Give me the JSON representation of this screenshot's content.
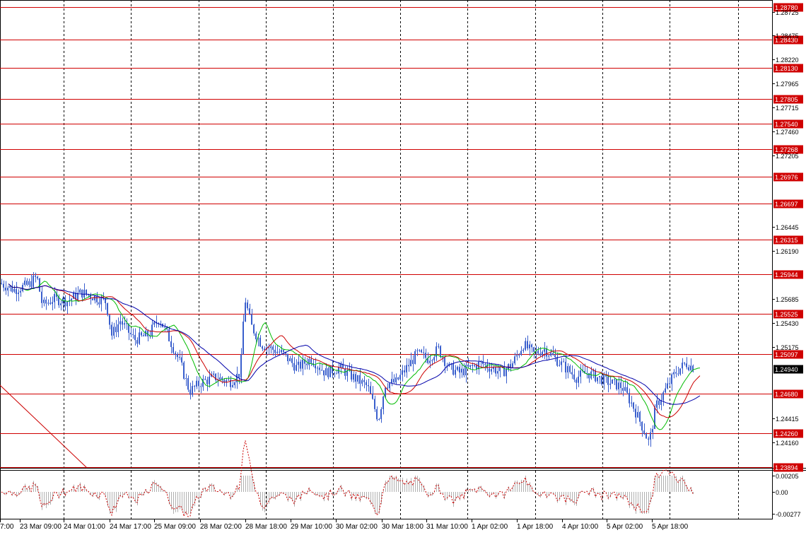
{
  "terminal": {
    "symbol_hint": "GBPUSD",
    "timeframe_hint": "H1"
  },
  "colors": {
    "background": "#ffffff",
    "grid": "#000000",
    "candles": "#3a5fcd",
    "level_line": "#d00000",
    "level_label_bg": "#d00000",
    "current_price_bg": "#000000",
    "ma_fast": "#00bb00",
    "ma_mid": "#cc0000",
    "ma_slow": "#0000aa",
    "trendline": "#cc0000",
    "osc_bars": "#b0b0b0",
    "osc_signal": "#cc0000"
  },
  "price_axis": {
    "ticks": [
      "1.28725",
      "1.28475",
      "1.28220",
      "1.27965",
      "1.27715",
      "1.27460",
      "1.27205",
      "1.26445",
      "1.26190",
      "1.25685",
      "1.25430",
      "1.25175",
      "1.24415",
      "1.24160"
    ]
  },
  "levels": [
    "1.28780",
    "1.28430",
    "1.28130",
    "1.27805",
    "1.27540",
    "1.27268",
    "1.26976",
    "1.26697",
    "1.26315",
    "1.25944",
    "1.25525",
    "1.25097",
    "1.24680",
    "1.24260",
    "1.23894"
  ],
  "current_price": "1.24940",
  "oscillator": {
    "ticks": [
      "0.00205",
      "0.00",
      "-0.00277"
    ]
  },
  "time_axis": {
    "labels": [
      "7:00",
      "23 Mar 09:00",
      "24 Mar 01:00",
      "24 Mar 17:00",
      "25 Mar 09:00",
      "28 Mar 02:00",
      "28 Mar 18:00",
      "29 Mar 10:00",
      "30 Mar 02:00",
      "30 Mar 18:00",
      "31 Mar 10:00",
      "1 Apr 02:00",
      "1 Apr 18:00",
      "4 Apr 10:00",
      "5 Apr 02:00",
      "5 Apr 18:00"
    ]
  },
  "chart_data": {
    "type": "candlestick",
    "price_range": [
      1.2389,
      1.2883
    ],
    "oscillator_range": [
      -0.00277,
      0.00205
    ],
    "horizontal_levels": [
      1.2878,
      1.2843,
      1.2813,
      1.27805,
      1.2754,
      1.27268,
      1.26976,
      1.26697,
      1.26315,
      1.25944,
      1.25525,
      1.25097,
      1.2468,
      1.2426,
      1.23894
    ],
    "close_path": [
      [
        0,
        1.2585
      ],
      [
        20,
        1.2578
      ],
      [
        40,
        1.2583
      ],
      [
        52,
        1.2592
      ],
      [
        60,
        1.2561
      ],
      [
        75,
        1.2568
      ],
      [
        95,
        1.2566
      ],
      [
        115,
        1.2575
      ],
      [
        135,
        1.257
      ],
      [
        150,
        1.2565
      ],
      [
        158,
        1.253
      ],
      [
        170,
        1.2545
      ],
      [
        190,
        1.2525
      ],
      [
        210,
        1.253
      ],
      [
        225,
        1.2548
      ],
      [
        240,
        1.2525
      ],
      [
        255,
        1.25
      ],
      [
        268,
        1.247
      ],
      [
        285,
        1.248
      ],
      [
        305,
        1.2485
      ],
      [
        325,
        1.248
      ],
      [
        340,
        1.249
      ],
      [
        346,
        1.257
      ],
      [
        355,
        1.254
      ],
      [
        370,
        1.252
      ],
      [
        385,
        1.2515
      ],
      [
        400,
        1.251
      ],
      [
        420,
        1.2495
      ],
      [
        440,
        1.2505
      ],
      [
        460,
        1.249
      ],
      [
        480,
        1.2495
      ],
      [
        500,
        1.2485
      ],
      [
        520,
        1.2475
      ],
      [
        535,
        1.244
      ],
      [
        545,
        1.2478
      ],
      [
        560,
        1.248
      ],
      [
        575,
        1.2495
      ],
      [
        590,
        1.251
      ],
      [
        605,
        1.2505
      ],
      [
        620,
        1.2515
      ],
      [
        635,
        1.2495
      ],
      [
        650,
        1.249
      ],
      [
        665,
        1.2495
      ],
      [
        680,
        1.25
      ],
      [
        695,
        1.2495
      ],
      [
        710,
        1.249
      ],
      [
        725,
        1.25
      ],
      [
        740,
        1.252
      ],
      [
        755,
        1.251
      ],
      [
        770,
        1.2515
      ],
      [
        785,
        1.2505
      ],
      [
        800,
        1.2495
      ],
      [
        815,
        1.2485
      ],
      [
        830,
        1.249
      ],
      [
        845,
        1.2485
      ],
      [
        860,
        1.248
      ],
      [
        880,
        1.2475
      ],
      [
        895,
        1.2455
      ],
      [
        910,
        1.243
      ],
      [
        918,
        1.2415
      ],
      [
        928,
        1.2455
      ],
      [
        940,
        1.247
      ],
      [
        955,
        1.249
      ],
      [
        970,
        1.25
      ],
      [
        982,
        1.2495
      ]
    ]
  }
}
